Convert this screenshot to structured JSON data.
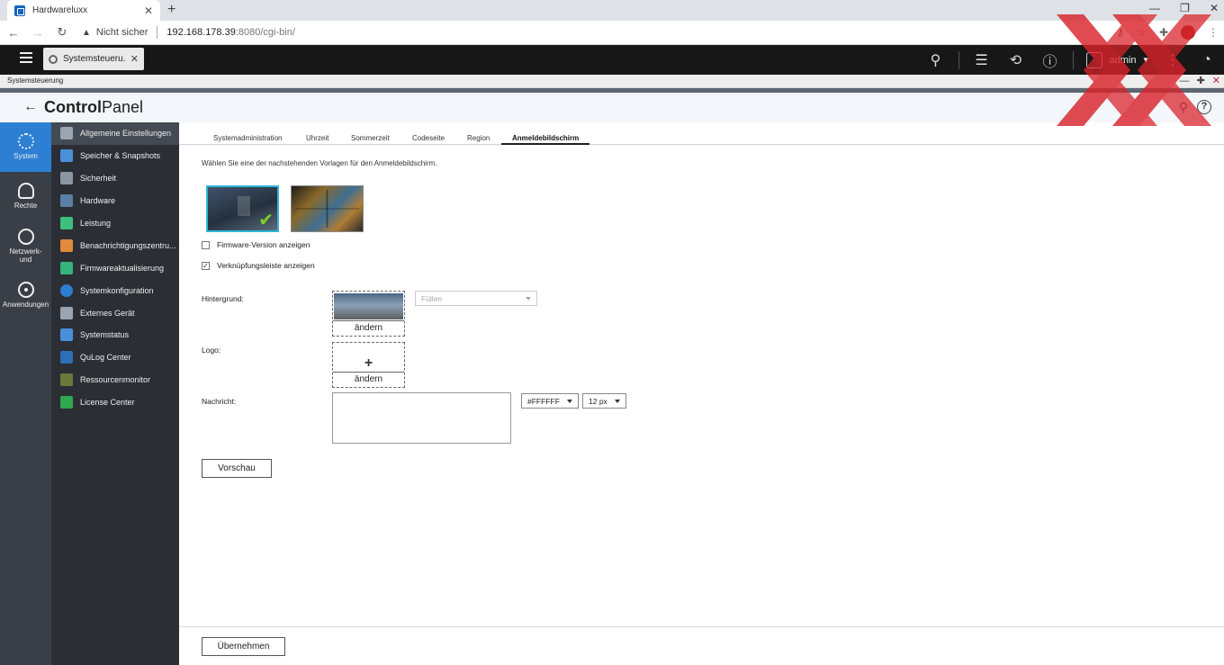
{
  "browser": {
    "tab_title": "Hardwareluxx",
    "address": {
      "security": "Nicht sicher",
      "host": "192.168.178.39",
      "path": ":8080/cgi-bin/"
    }
  },
  "qts": {
    "task_title": "Systemsteueru...",
    "user": "admin"
  },
  "window": {
    "title": "Systemsteuerung"
  },
  "app": {
    "title_bold": "Control",
    "title_light": "Panel"
  },
  "rail": [
    {
      "label": "System",
      "icon": "gear-icon"
    },
    {
      "label": "Rechte",
      "icon": "person-icon"
    },
    {
      "label": "Netzwerk-\nund",
      "icon": "globe-icon"
    },
    {
      "label": "Anwendungen",
      "icon": "grid-icon"
    }
  ],
  "submenu": [
    {
      "label": "Allgemeine Einstellungen",
      "color": "#9aa5b1"
    },
    {
      "label": "Speicher & Snapshots",
      "color": "#4a90d9"
    },
    {
      "label": "Sicherheit",
      "color": "#8c96a3"
    },
    {
      "label": "Hardware",
      "color": "#5b7fa6"
    },
    {
      "label": "Leistung",
      "color": "#3fbf7f"
    },
    {
      "label": "Benachrichtigungszentru...",
      "color": "#e08a3c"
    },
    {
      "label": "Firmwareaktualisierung",
      "color": "#36b37e"
    },
    {
      "label": "Systemkonfiguration",
      "color": "#2d7fd3"
    },
    {
      "label": "Externes Gerät",
      "color": "#9aa5b1"
    },
    {
      "label": "Systemstatus",
      "color": "#4a90d9"
    },
    {
      "label": "QuLog Center",
      "color": "#2d6fb7"
    },
    {
      "label": "Ressourcenmonitor",
      "color": "#6b7a3a"
    },
    {
      "label": "License Center",
      "color": "#2fa84f"
    }
  ],
  "tabs": [
    "Systemadministration",
    "Uhrzeit",
    "Sommerzeit",
    "Codeseite",
    "Region",
    "Anmeldebildschirm"
  ],
  "content": {
    "intro": "Wählen Sie eine der nachstehenden Vorlagen für den Anmeldebildschirm.",
    "checkbox_firmware": "Firmware-Version anzeigen",
    "checkbox_firmware_checked": false,
    "checkbox_links": "Verknüpfungsleiste anzeigen",
    "checkbox_links_checked": true,
    "label_background": "Hintergrund:",
    "label_logo": "Logo:",
    "label_message": "Nachricht:",
    "change": "ändern",
    "fill_select": "Füllen",
    "color_select": "#FFFFFF",
    "size_select": "12 px",
    "preview_button": "Vorschau",
    "apply_button": "Übernehmen"
  }
}
